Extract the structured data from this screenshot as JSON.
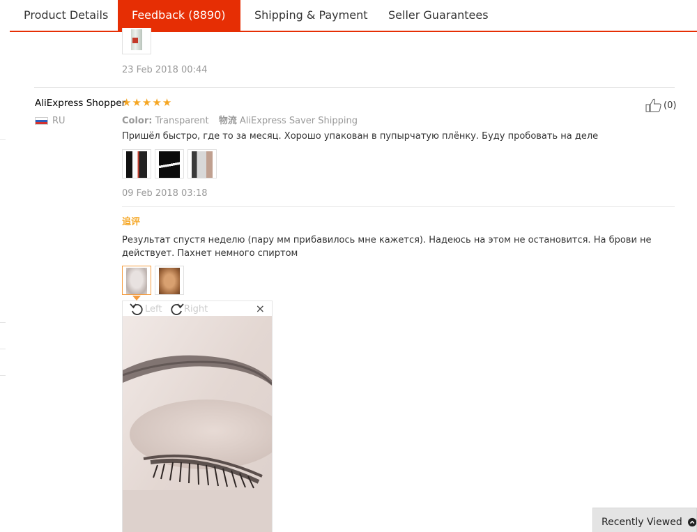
{
  "tabs": [
    {
      "label": "Product Details",
      "active": false
    },
    {
      "label": "Feedback (8890)",
      "active": true
    },
    {
      "label": "Shipping & Payment",
      "active": false
    },
    {
      "label": "Seller Guarantees",
      "active": false
    }
  ],
  "previous_review": {
    "date": "23 Feb 2018 00:44"
  },
  "review": {
    "user_name": "AliExpress Shopper",
    "country": "RU",
    "stars": 5,
    "helpful_count": "(0)",
    "color_label": "Color:",
    "color_value": "Transparent",
    "logistics_label": "物流",
    "logistics_value": "AliExpress Saver Shipping",
    "text": "Пришёл быстро, где то за месяц. Хорошо упакован в пупырчатую плёнку. Буду пробовать на деле",
    "date": "09 Feb 2018 03:18",
    "followup_label": "追评",
    "followup_text": "Результат спустя неделю (пару мм прибавилось мне кажется). Надеюсь на этом не остановится. На брови не действует. Пахнет немного спиртом"
  },
  "viewer": {
    "rotate_left_label": "Left",
    "rotate_right_label": "Right",
    "close_glyph": "×"
  },
  "recently_viewed": {
    "label": "Recently Viewed"
  },
  "colors": {
    "accent": "#e62e04",
    "star": "#f5a623",
    "muted": "#999999"
  }
}
